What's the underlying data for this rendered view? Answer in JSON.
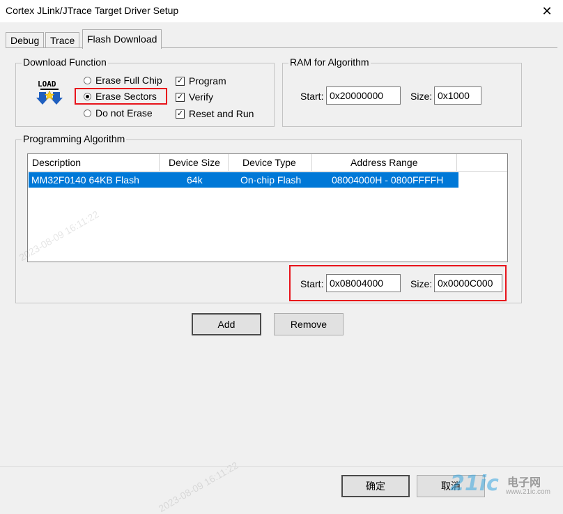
{
  "window": {
    "title": "Cortex JLink/JTrace Target Driver Setup",
    "close_glyph": "✕"
  },
  "tabs": [
    {
      "label": "Debug",
      "active": false
    },
    {
      "label": "Trace",
      "active": false
    },
    {
      "label": "Flash Download",
      "active": true
    }
  ],
  "download_function": {
    "legend": "Download Function",
    "icon": "load-icon",
    "icon_text": "LOAD",
    "erase_options": [
      {
        "label": "Erase Full Chip",
        "selected": false
      },
      {
        "label": "Erase Sectors",
        "selected": true
      },
      {
        "label": "Do not Erase",
        "selected": false
      }
    ],
    "checks": [
      {
        "label": "Program",
        "checked": true
      },
      {
        "label": "Verify",
        "checked": true
      },
      {
        "label": "Reset and Run",
        "checked": true
      }
    ]
  },
  "ram_for_algorithm": {
    "legend": "RAM for Algorithm",
    "start_label": "Start:",
    "start_value": "0x20000000",
    "size_label": "Size:",
    "size_value": "0x1000"
  },
  "programming_algorithm": {
    "legend": "Programming Algorithm",
    "columns": [
      "Description",
      "Device Size",
      "Device Type",
      "Address Range"
    ],
    "rows": [
      {
        "description": "MM32F0140 64KB Flash",
        "device_size": "64k",
        "device_type": "On-chip Flash",
        "address_range": "08004000H - 0800FFFFH",
        "selected": true
      }
    ],
    "start_label": "Start:",
    "start_value": "0x08004000",
    "size_label": "Size:",
    "size_value": "0x0000C000"
  },
  "buttons": {
    "add": "Add",
    "remove": "Remove",
    "ok": "确定",
    "cancel": "取消"
  },
  "watermarks": {
    "timestamp_mid": "2023-08-09 16:11:22",
    "timestamp_bottom": "2023-08-09 16:11:22",
    "brand": "21ic",
    "brand_cn": "电子网",
    "brand_url": "www.21ic.com"
  },
  "colors": {
    "selection": "#0078d7",
    "highlight_box": "#e8131b"
  }
}
